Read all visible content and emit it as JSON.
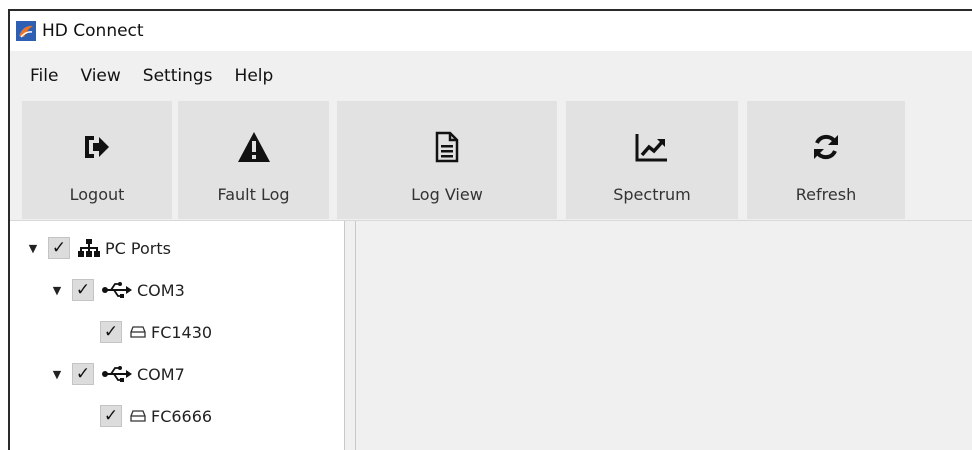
{
  "window": {
    "title": "HD Connect"
  },
  "menu": [
    "File",
    "View",
    "Settings",
    "Help"
  ],
  "toolbar": {
    "logout": "Logout",
    "fault_log": "Fault Log",
    "log_view": "Log View",
    "spectrum": "Spectrum",
    "refresh": "Refresh"
  },
  "tree": {
    "root": {
      "label": "PC Ports",
      "checked": true,
      "expanded": true
    },
    "port1": {
      "label": "COM3",
      "checked": true,
      "expanded": true
    },
    "device1": {
      "label": "FC1430",
      "checked": true
    },
    "port2": {
      "label": "COM7",
      "checked": true,
      "expanded": true
    },
    "device2": {
      "label": "FC6666",
      "checked": true
    }
  },
  "glyphs": {
    "check": "✓",
    "expanded": "▼"
  },
  "colors": {
    "toolbar_button": "#e2e2e2",
    "toolbar_bg": "#f0f0f0",
    "window_border": "#2a2a2a"
  }
}
